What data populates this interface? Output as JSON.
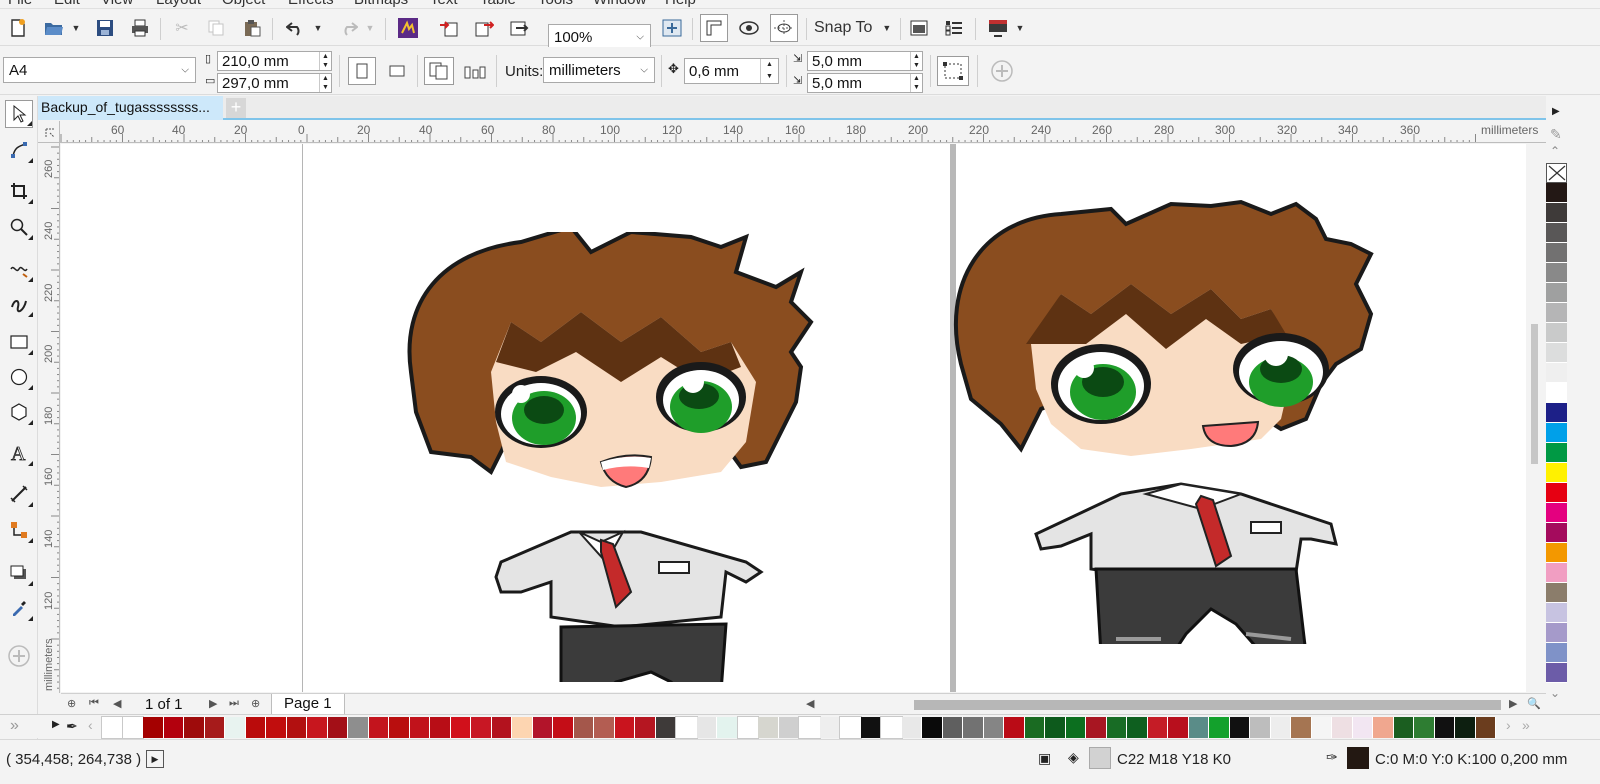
{
  "menu": [
    "File",
    "Edit",
    "View",
    "Layout",
    "Object",
    "Effects",
    "Bitmaps",
    "Text",
    "Table",
    "Tools",
    "Window",
    "Help"
  ],
  "toolbar": {
    "zoom_value": "100%",
    "snap_label": "Snap To",
    "icons": [
      "new-icon",
      "open-icon",
      "save-icon",
      "print-icon",
      "cut-icon",
      "copy-icon",
      "paste-icon",
      "undo-icon",
      "redo-icon",
      "search-content-icon",
      "import-icon",
      "export-icon",
      "publish-pdf-icon",
      "full-screen-icon",
      "rulers-icon",
      "show-guides-icon",
      "snap-guides-icon",
      "welcome-icon",
      "options-icon",
      "launch-icon"
    ]
  },
  "propbar": {
    "page_size": "A4",
    "width": "210,0 mm",
    "height": "297,0 mm",
    "units_label": "Units:",
    "units_value": "millimeters",
    "nudge": "0,6 mm",
    "dup_x": "5,0 mm",
    "dup_y": "5,0 mm"
  },
  "document": {
    "tab_title": "Backup_of_tugassssssss..."
  },
  "ruler": {
    "h_labels": [
      "60",
      "40",
      "20",
      "0",
      "20",
      "40",
      "60",
      "80",
      "100",
      "120",
      "140",
      "160",
      "180",
      "200",
      "220",
      "240",
      "260",
      "280",
      "300",
      "320",
      "340",
      "360"
    ],
    "h_unit": "millimeters",
    "v_labels": [
      "260",
      "240",
      "220",
      "200",
      "180",
      "160",
      "140",
      "120"
    ],
    "v_unit": "millimeters"
  },
  "navigator": {
    "page_count": "1 of 1",
    "page_tab": "Page 1"
  },
  "status": {
    "coords": "( 354,458; 264,738 )",
    "fill_text": "C22 M18 Y18 K0",
    "outline_text": "C:0 M:0 Y:0 K:100  0,200 mm"
  },
  "colors": {
    "hair": "#8a4d1f",
    "hair_dark": "#5e3212",
    "skin": "#f9dcc3",
    "eye_green": "#1f9e2a",
    "tie": "#c42a2a",
    "shirt": "#e4e4e4",
    "pants": "#3b3b3b",
    "accent": "#7fc4ea",
    "tab_selected": "#cde8fa"
  },
  "right_palette": [
    "#ffffff",
    "#231815",
    "#3e3a39",
    "#595757",
    "#727171",
    "#898989",
    "#9fa0a0",
    "#b5b5b6",
    "#c9caca",
    "#dcdddd",
    "#efefef",
    "#ffffff",
    "#1d2088",
    "#00a0e9",
    "#009944",
    "#fff100",
    "#e60012",
    "#e4007f",
    "#a40b5d",
    "#f39800",
    "#f19ec2",
    "#8b7d6b",
    "#c7c3e1",
    "#a59aca",
    "#7f92c8",
    "#6c5ca8"
  ],
  "bottom_palette": [
    "#ffffff",
    "#ffffff",
    "#a40000",
    "#b3000d",
    "#9e0b0b",
    "#a61b1b",
    "#e8f3f0",
    "#ba0b0b",
    "#c10d0d",
    "#b21010",
    "#c7161e",
    "#a30f17",
    "#8e8e8e",
    "#c3141d",
    "#b90e0e",
    "#c1121b",
    "#b80d16",
    "#d1101b",
    "#c81724",
    "#b3121e",
    "#fdd5b1",
    "#b2142a",
    "#c40d17",
    "#a4574b",
    "#b35d52",
    "#c9141e",
    "#b51621",
    "#3e3a39",
    "#ffffff",
    "#e6e6e6",
    "#e3f3ee",
    "#ffffff",
    "#d6d6cf",
    "#cfcfcf",
    "#ffffff",
    "#eeeeee",
    "#ffffff",
    "#111111",
    "#ffffff",
    "#e8e8e8",
    "#0a0a0a",
    "#5f5f5f",
    "#727272",
    "#858585",
    "#ba0b16",
    "#1a6b22",
    "#0d5a1c",
    "#0c6f1f",
    "#a81622",
    "#186c25",
    "#0e5f1f",
    "#c51c26",
    "#b80f1d",
    "#5a8c88",
    "#13a12c",
    "#111111",
    "#bdbdbd",
    "#ededed",
    "#a57552",
    "#f5f5f5",
    "#eedfe3",
    "#f2e6f2",
    "#f0a78f",
    "#1b5e20",
    "#2e7d32",
    "#111111",
    "#0d1f10",
    "#6b3d1e"
  ]
}
